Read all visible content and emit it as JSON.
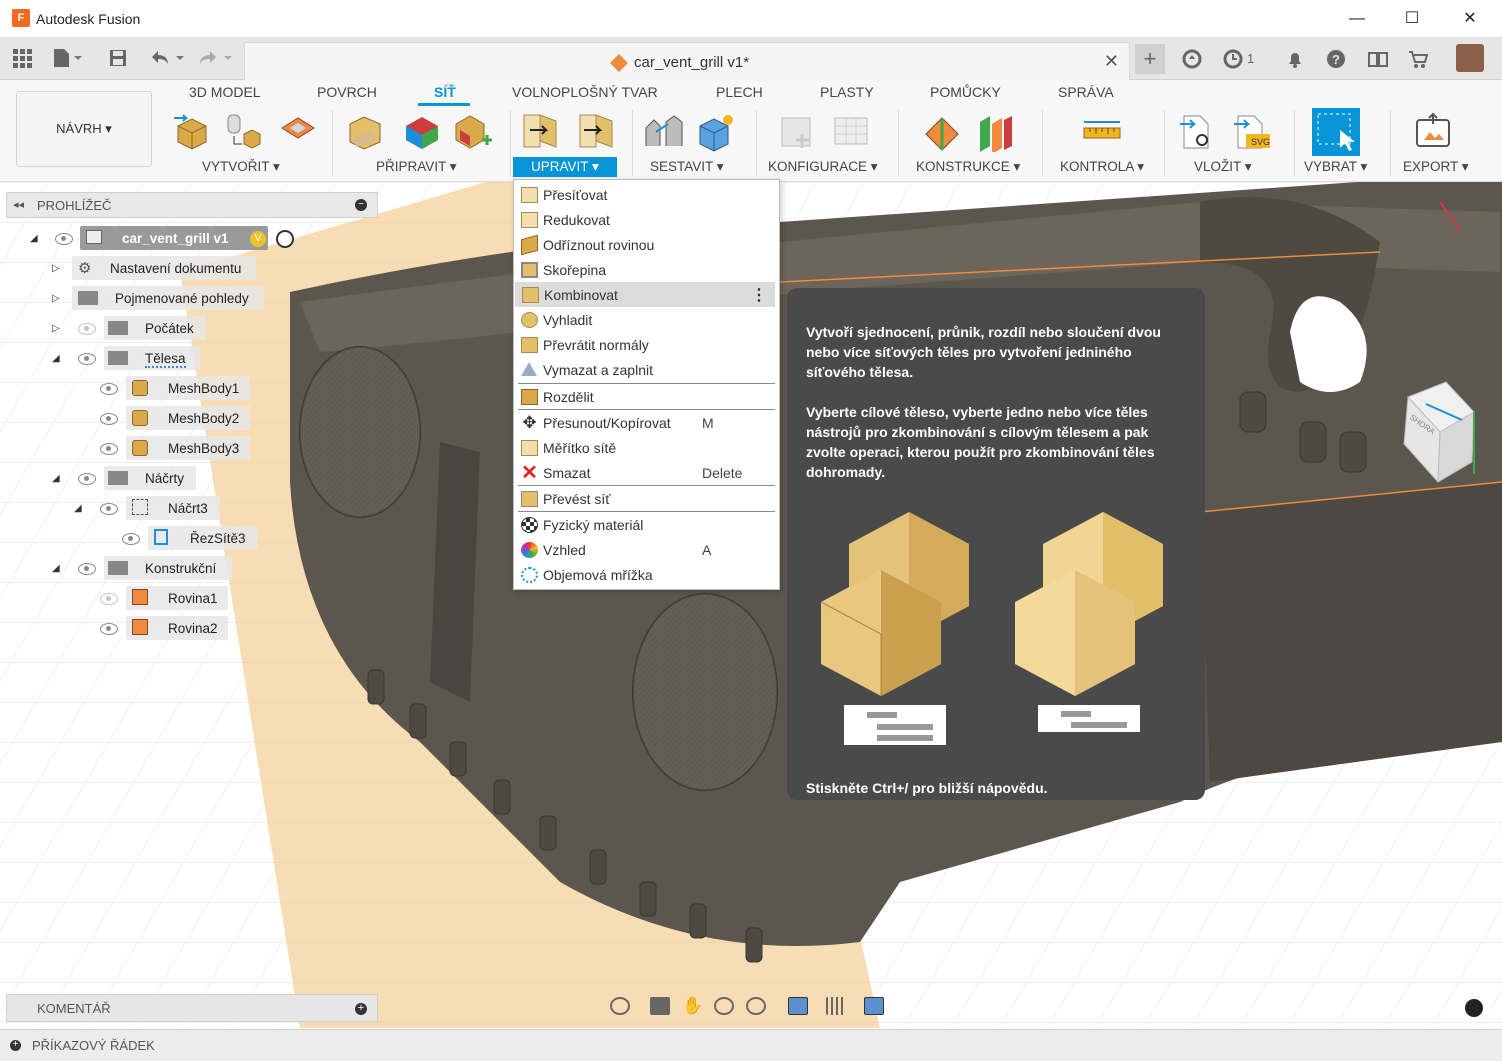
{
  "window": {
    "app_title": "Autodesk Fusion",
    "minimize": "—",
    "maximize": "☐",
    "close": "✕"
  },
  "doc_tab": {
    "title": "car_vent_grill v1*",
    "close": "✕"
  },
  "toolbar_right": {
    "plus": "+",
    "jobs_count": "1"
  },
  "workspace": {
    "label": "NÁVRH ▾"
  },
  "ribbon_tabs": [
    "3D MODEL",
    "POVRCH",
    "SÍŤ",
    "VOLNOPLOŠNÝ TVAR",
    "PLECH",
    "PLASTY",
    "POMŮCKY",
    "SPRÁVA"
  ],
  "active_tab": "SÍŤ",
  "groups": {
    "create": "VYTVOŘIT ▾",
    "prepare": "PŘIPRAVIT ▾",
    "modify": "UPRAVIT ▾",
    "assemble": "SESTAVIT ▾",
    "configure": "KONFIGURACE ▾",
    "construct": "KONSTRUKCE ▾",
    "inspect": "KONTROLA ▾",
    "insert": "VLOŽIT ▾",
    "select": "VYBRAT ▾",
    "export": "EXPORT ▾"
  },
  "browser": {
    "title": "PROHLÍŽEČ",
    "root": "car_vent_grill v1",
    "items": [
      {
        "label": "Nastavení dokumentu"
      },
      {
        "label": "Pojmenované pohledy"
      },
      {
        "label": "Počátek"
      },
      {
        "label": "Tělesa"
      },
      {
        "label": "MeshBody1"
      },
      {
        "label": "MeshBody2"
      },
      {
        "label": "MeshBody3"
      },
      {
        "label": "Náčrty"
      },
      {
        "label": "Náčrt3"
      },
      {
        "label": "ŘezSítě3"
      },
      {
        "label": "Konstrukční"
      },
      {
        "label": "Rovina1"
      },
      {
        "label": "Rovina2"
      }
    ]
  },
  "menu": {
    "items": [
      {
        "label": "Přesíťovat",
        "shortcut": ""
      },
      {
        "label": "Redukovat",
        "shortcut": ""
      },
      {
        "label": "Odříznout rovinou",
        "shortcut": ""
      },
      {
        "label": "Skořepina",
        "shortcut": ""
      },
      {
        "label": "Kombinovat",
        "shortcut": ""
      },
      {
        "label": "Vyhladit",
        "shortcut": ""
      },
      {
        "label": "Převrátit normály",
        "shortcut": ""
      },
      {
        "label": "Vymazat a zaplnit",
        "shortcut": ""
      },
      {
        "label": "Rozdělit",
        "shortcut": ""
      },
      {
        "label": "Přesunout/Kopírovat",
        "shortcut": "M"
      },
      {
        "label": "Měřítko sítě",
        "shortcut": ""
      },
      {
        "label": "Smazat",
        "shortcut": "Delete"
      },
      {
        "label": "Převést síť",
        "shortcut": ""
      },
      {
        "label": "Fyzický materiál",
        "shortcut": ""
      },
      {
        "label": "Vzhled",
        "shortcut": "A"
      },
      {
        "label": "Objemová mřížka",
        "shortcut": ""
      }
    ],
    "hovered": "Kombinovat"
  },
  "tooltip": {
    "para1": "Vytvoří sjednocení, průnik, rozdíl nebo sloučení dvou nebo více síťových těles pro vytvoření jedniného síťového tělesa.",
    "para2": "Vyberte cílové těleso, vyberte jedno nebo více těles nástrojů pro zkombinování s cílovým tělesem a pak zvolte operaci, kterou použít pro zkombinování těles dohromady.",
    "footer": "Stiskněte Ctrl+/ pro bližší nápovědu."
  },
  "viewcube": {
    "face": "SHORA"
  },
  "comment": {
    "title": "KOMENTÁŘ"
  },
  "command_line": {
    "title": "PŘÍKAZOVÝ ŘÁDEK"
  },
  "colors": {
    "accent": "#0696d7",
    "tooltip_bg": "#4a4a4a",
    "model": "#5a554c",
    "plane": "#f5c98a",
    "body_gold": "#e3bf6a"
  }
}
